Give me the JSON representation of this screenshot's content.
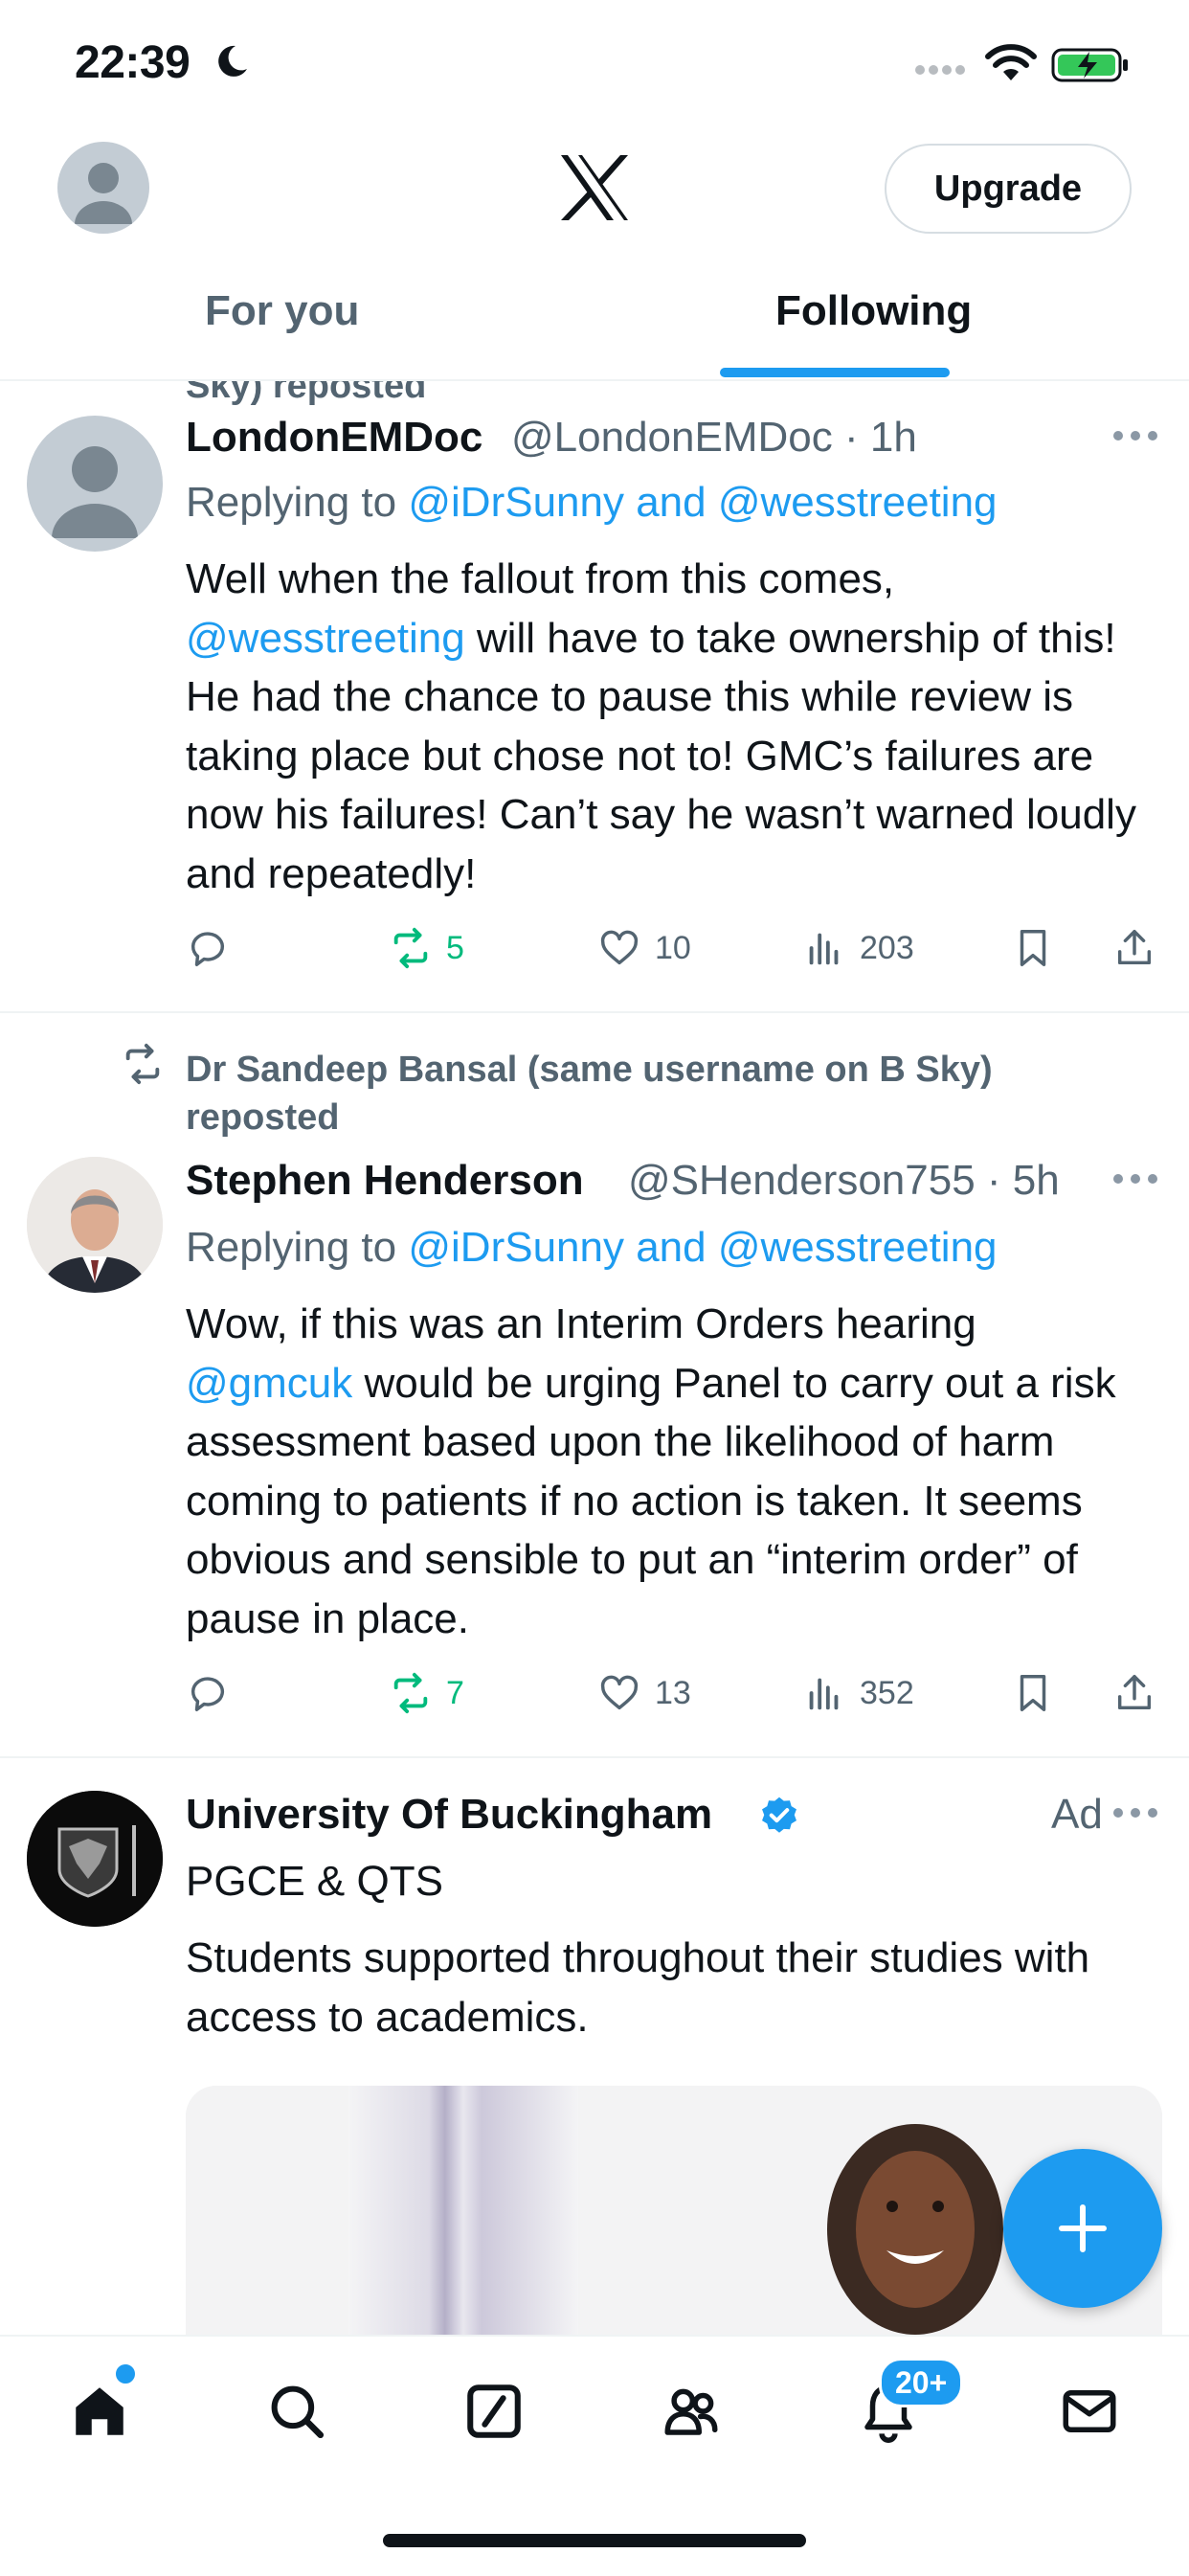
{
  "status_bar": {
    "time": "22:39"
  },
  "header": {
    "upgrade_label": "Upgrade"
  },
  "tabs": [
    {
      "label": "For you"
    },
    {
      "label": "Following"
    }
  ],
  "cut_off_repost_text": "Sky) reposted",
  "posts": [
    {
      "author_name": "LondonEMDoc",
      "handle": "@LondonEMDoc",
      "time": "· 1h",
      "replying_prefix": "Replying to ",
      "replying_targets": "@iDrSunny and @wesstreeting",
      "body_line1": "Well when the fallout from this comes,",
      "body_mention": "@wesstreeting",
      "body_rest": " will have to take ownership of this! He had the chance to pause this while review is taking place but chose not to! GMC’s failures are now his failures! Can’t say he wasn’t warned loudly and repeatedly!",
      "reposts": "5",
      "likes": "10",
      "views": "203"
    },
    {
      "repost_text": "Dr Sandeep Bansal (same username on B Sky) reposted",
      "author_name": "Stephen Henderson",
      "handle": "@SHenderson755",
      "time": "· 5h",
      "replying_prefix": "Replying to ",
      "replying_targets": "@iDrSunny and @wesstreeting",
      "body_line1": "Wow, if this was an Interim Orders hearing",
      "body_mention": "@gmcuk",
      "body_rest": " would be urging Panel to carry out a risk assessment based upon the likelihood of harm coming to patients if no action is taken. It seems obvious and sensible to put an “interim order” of pause in place.",
      "reposts": "7",
      "likes": "13",
      "views": "352"
    },
    {
      "author_name": "University Of Buckingham",
      "ad_label": "Ad",
      "subtitle": "PGCE & QTS",
      "body": "Students supported throughout their studies with access to academics."
    }
  ],
  "notifications_badge": "20+",
  "icons": {
    "status": [
      "moon-icon",
      "signal-icon",
      "wifi-icon",
      "battery-charging-icon"
    ],
    "nav": [
      "home-icon",
      "search-icon",
      "grok-icon",
      "communities-icon",
      "bell-icon",
      "mail-icon"
    ],
    "actions": [
      "reply-icon",
      "repost-icon",
      "like-icon",
      "views-icon",
      "bookmark-icon",
      "share-icon"
    ]
  },
  "colors": {
    "accent": "#1d9bf0",
    "repost_green": "#00ba7c",
    "muted": "#536471",
    "text": "#0f1419"
  }
}
